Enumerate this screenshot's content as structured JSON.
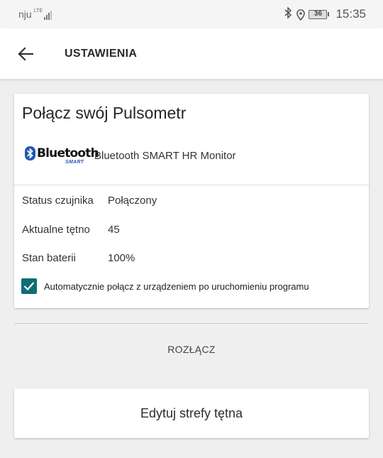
{
  "status_bar": {
    "carrier": "nju",
    "network": "LTE",
    "battery": "36",
    "time": "15:35"
  },
  "app_bar": {
    "title": "USTAWIENIA"
  },
  "heart_rate_card": {
    "title": "Połącz swój Pulsometr",
    "logo": {
      "word": "Bluetooth",
      "sub": "SMART"
    },
    "device_name": "Bluetooth SMART HR Monitor",
    "rows": [
      {
        "label": "Status czujnika",
        "value": "Połączony"
      },
      {
        "label": "Aktualne tętno",
        "value": "45"
      },
      {
        "label": "Stan baterii",
        "value": "100%"
      }
    ],
    "auto_connect": {
      "checked": true,
      "label": "Automatycznie połącz z urządzeniem po uruchomieniu programu"
    }
  },
  "disconnect_label": "ROZŁĄCZ",
  "edit_zones_label": "Edytuj strefy tętna",
  "colors": {
    "accent": "#0d6e74",
    "bluetooth": "#1f58b5",
    "background": "#efefef"
  }
}
